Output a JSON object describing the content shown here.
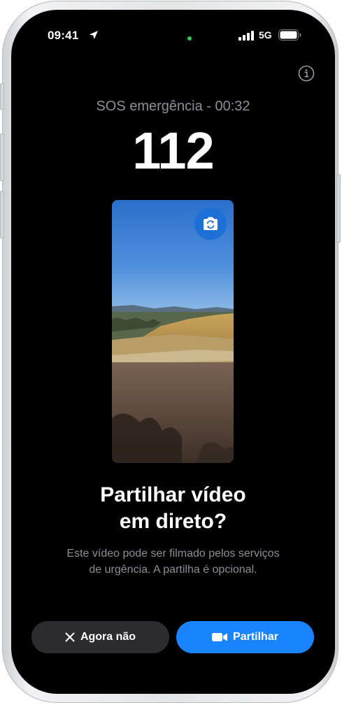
{
  "status_bar": {
    "time": "09:41",
    "network": "5G",
    "icons": [
      "location-arrow-icon",
      "signal-bars-icon",
      "battery-icon"
    ]
  },
  "sos": {
    "title": "SOS emergência - 00:32",
    "number": "112"
  },
  "preview": {
    "icon": "camera-flip-icon"
  },
  "prompt": {
    "heading_line1": "Partilhar vídeo",
    "heading_line2": "em direto?",
    "description_line1": "Este vídeo pode ser filmado pelos serviços",
    "description_line2": "de urgência. A partilha é opcional."
  },
  "actions": {
    "decline_label": "Agora não",
    "share_label": "Partilhar"
  },
  "colors": {
    "accent": "#1a84ff",
    "secondary_button": "#2c2c2e",
    "muted_text": "#8e8e93",
    "camera_indicator": "#34c759"
  }
}
